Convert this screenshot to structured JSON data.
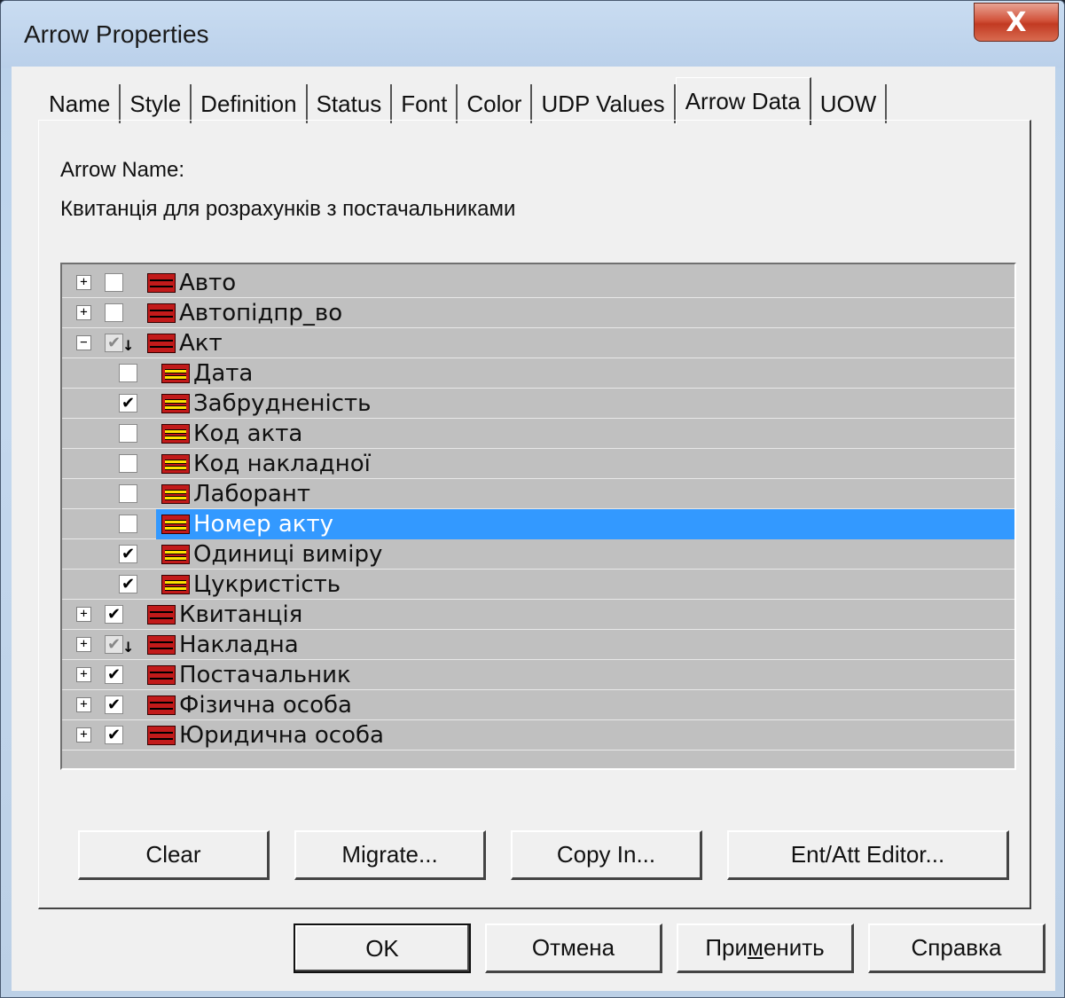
{
  "window": {
    "title": "Arrow Properties",
    "close_label": "X"
  },
  "tabs": [
    {
      "label": "Name"
    },
    {
      "label": "Style"
    },
    {
      "label": "Definition"
    },
    {
      "label": "Status"
    },
    {
      "label": "Font"
    },
    {
      "label": "Color"
    },
    {
      "label": "UDP Values"
    },
    {
      "label": "Arrow Data",
      "active": true
    },
    {
      "label": "UOW"
    }
  ],
  "arrow_name": {
    "label": "Arrow Name:",
    "value": "Квитанція для розрахунків з постачальниками"
  },
  "tree": {
    "rows": [
      {
        "text": "Авто",
        "level": 0,
        "expander": "+",
        "checked": "unchecked"
      },
      {
        "text": "Автопідпр_во",
        "level": 0,
        "expander": "+",
        "checked": "unchecked"
      },
      {
        "text": "Акт",
        "level": 0,
        "expander": "−",
        "checked": "partial"
      },
      {
        "text": "Дата",
        "level": 1,
        "checked": "unchecked"
      },
      {
        "text": "Забрудненість",
        "level": 1,
        "checked": "checked"
      },
      {
        "text": "Код акта",
        "level": 1,
        "checked": "unchecked"
      },
      {
        "text": "Код накладної",
        "level": 1,
        "checked": "unchecked"
      },
      {
        "text": "Лаборант",
        "level": 1,
        "checked": "unchecked"
      },
      {
        "text": "Номер акту",
        "level": 1,
        "checked": "unchecked",
        "selected": true
      },
      {
        "text": "Одиниці виміру",
        "level": 1,
        "checked": "checked"
      },
      {
        "text": "Цукристість",
        "level": 1,
        "checked": "checked"
      },
      {
        "text": "Квитанція",
        "level": 0,
        "expander": "+",
        "checked": "checked"
      },
      {
        "text": "Накладна",
        "level": 0,
        "expander": "+",
        "checked": "partial"
      },
      {
        "text": "Постачальник",
        "level": 0,
        "expander": "+",
        "checked": "checked"
      },
      {
        "text": "Фізична особа",
        "level": 0,
        "expander": "+",
        "checked": "checked"
      },
      {
        "text": "Юридична особа",
        "level": 0,
        "expander": "+",
        "checked": "checked"
      }
    ]
  },
  "actions": {
    "clear": "Clear",
    "migrate": "Migrate...",
    "copy_in": "Copy In...",
    "ent_att_editor": "Ent/Att Editor..."
  },
  "footer": {
    "ok": "OK",
    "cancel": "Отмена",
    "apply_pre": "При",
    "apply_u": "м",
    "apply_post": "енить",
    "help": "Справка"
  },
  "colors": {
    "selection": "#3399ff",
    "entity_icon": "#c21a1a",
    "attribute_bar": "#ffe000"
  }
}
